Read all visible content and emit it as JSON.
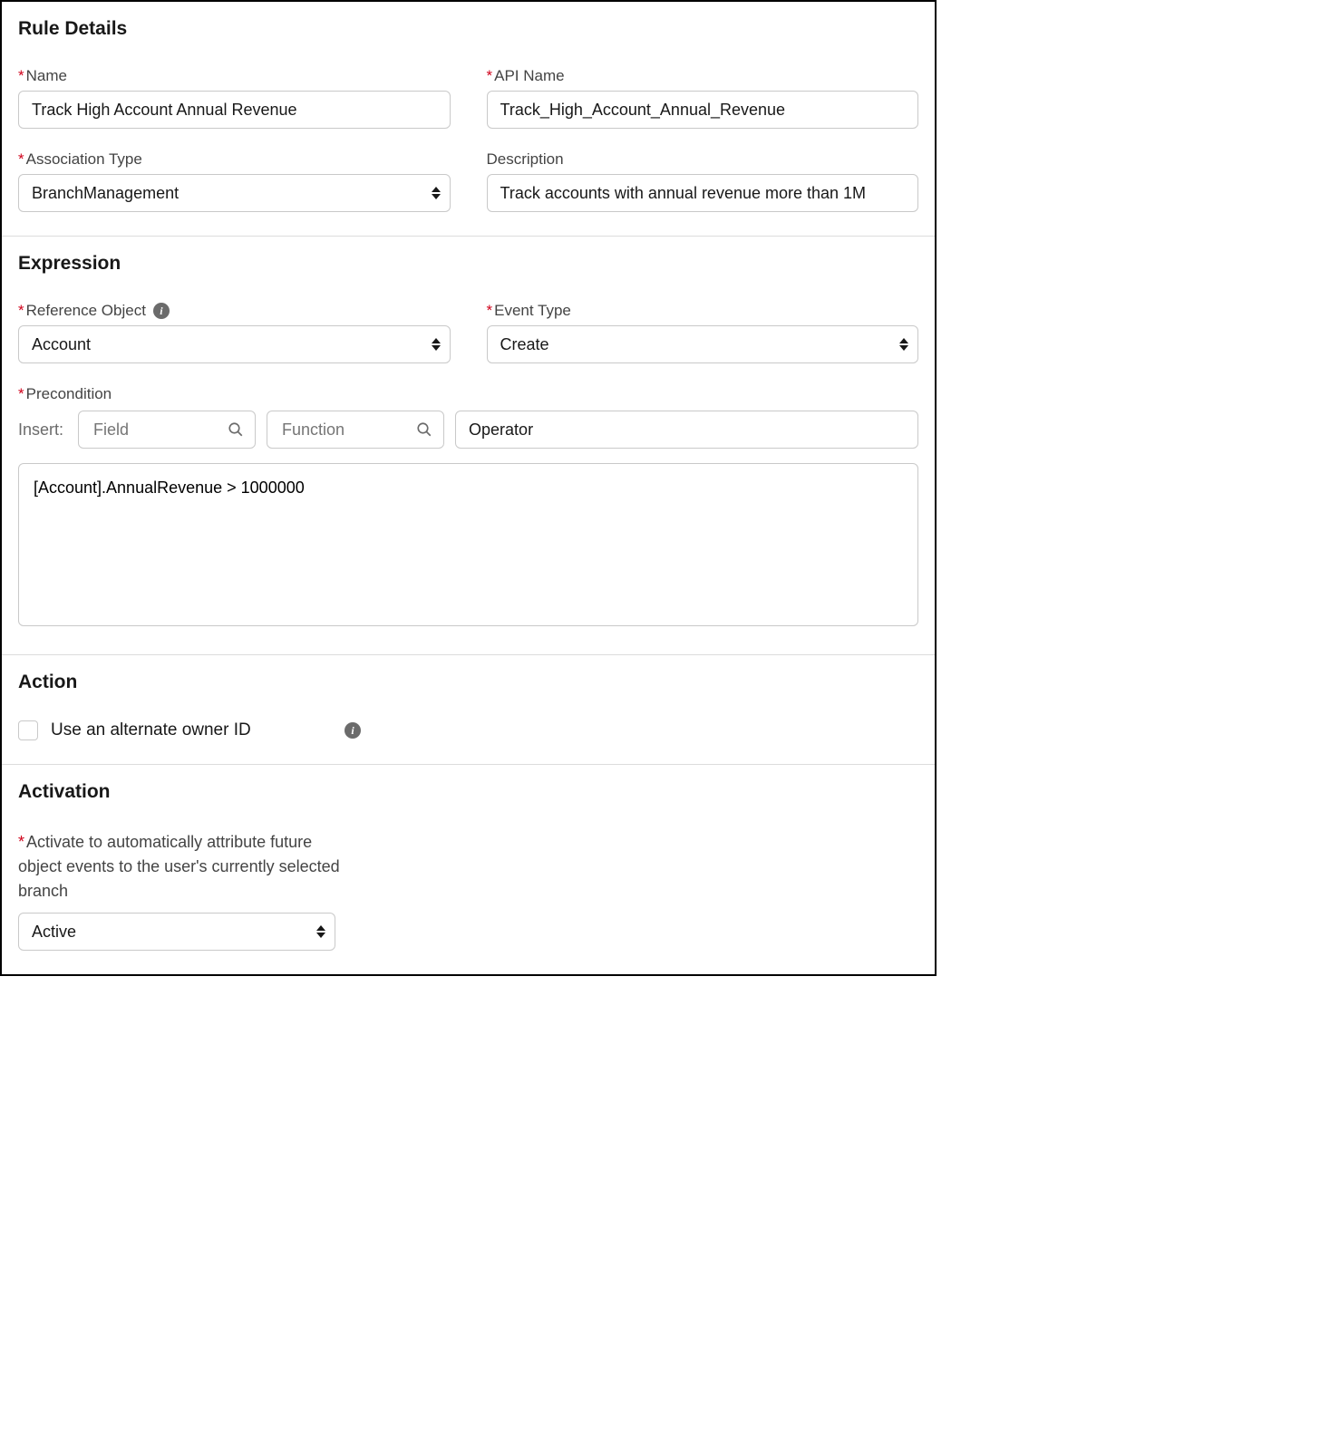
{
  "sections": {
    "ruleDetails": {
      "title": "Rule Details",
      "name": {
        "label": "Name",
        "value": "Track High Account Annual Revenue"
      },
      "apiName": {
        "label": "API Name",
        "value": "Track_High_Account_Annual_Revenue"
      },
      "associationType": {
        "label": "Association Type",
        "value": "BranchManagement"
      },
      "description": {
        "label": "Description",
        "value": "Track accounts with annual revenue more than 1M"
      }
    },
    "expression": {
      "title": "Expression",
      "referenceObject": {
        "label": "Reference Object",
        "value": "Account"
      },
      "eventType": {
        "label": "Event Type",
        "value": "Create"
      },
      "precondition": {
        "label": "Precondition",
        "insertLabel": "Insert:",
        "fieldPlaceholder": "Field",
        "functionPlaceholder": "Function",
        "operatorPlaceholder": "Operator",
        "value": "[Account].AnnualRevenue > 1000000"
      }
    },
    "action": {
      "title": "Action",
      "alternateOwner": {
        "label": "Use an alternate owner ID",
        "checked": false
      }
    },
    "activation": {
      "title": "Activation",
      "activate": {
        "label": "Activate to automatically attribute future object events to the user's currently selected branch",
        "value": "Active"
      }
    }
  }
}
